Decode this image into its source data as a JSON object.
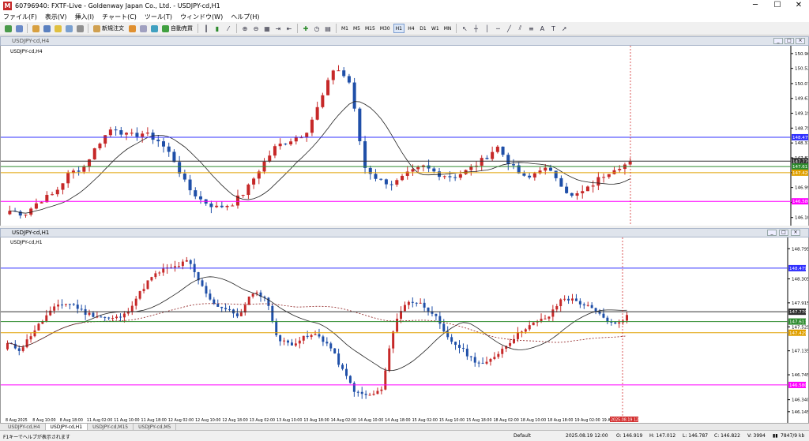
{
  "window": {
    "title": "60796940: FXTF-Live - Goldenway Japan Co., Ltd. - USDJPY-cd,H1",
    "minimize": "─",
    "maximize": "☐",
    "close": "✕"
  },
  "menu": [
    "ファイル(F)",
    "表示(V)",
    "挿入(I)",
    "チャート(C)",
    "ツール(T)",
    "ウィンドウ(W)",
    "ヘルプ(H)"
  ],
  "toolbar": {
    "new_order_label": "新規注文",
    "auto_trade_label": "自動売買",
    "timeframes": [
      "M1",
      "M5",
      "M15",
      "M30",
      "H1",
      "H4",
      "D1",
      "W1",
      "MN"
    ],
    "active_timeframe": "H1"
  },
  "top_chart": {
    "window_title": "USDJPY-cd,H4",
    "symbol_label": "USDJPY-cd,H4",
    "price_labels": [
      "150.960",
      "150.520",
      "150.070",
      "149.630",
      "149.190",
      "148.750",
      "148.310",
      "147.870",
      "147.430",
      "146.990",
      "146.550",
      "146.100"
    ],
    "hlines": [
      {
        "price": "148.479",
        "color": "#3030ff"
      },
      {
        "price": "147.770",
        "color": "#303030"
      },
      {
        "price": "147.611",
        "color": "#2e8b2e"
      },
      {
        "price": "147.429",
        "color": "#e0a000"
      },
      {
        "price": "146.580",
        "color": "#ff00ff"
      }
    ],
    "xlabels": []
  },
  "bottom_chart": {
    "window_title": "USDJPY-cd,H1",
    "symbol_label": "USDJPY-cd,H1",
    "price_labels": [
      "148.795",
      "148.305",
      "147.915",
      "147.525",
      "147.135",
      "146.745",
      "146.340",
      "146.145"
    ],
    "hlines": [
      {
        "price": "148.479",
        "color": "#3030ff"
      },
      {
        "price": "147.770",
        "color": "#303030"
      },
      {
        "price": "147.611",
        "color": "#2e8b2e"
      },
      {
        "price": "147.429",
        "color": "#e0a000"
      },
      {
        "price": "146.580",
        "color": "#ff00ff"
      }
    ],
    "xlabels": [
      "8 Aug 2025",
      "8 Aug 10:00",
      "8 Aug 18:00",
      "11 Aug 02:00",
      "11 Aug 10:00",
      "11 Aug 18:00",
      "12 Aug 02:00",
      "12 Aug 10:00",
      "12 Aug 18:00",
      "13 Aug 02:00",
      "13 Aug 10:00",
      "13 Aug 18:00",
      "14 Aug 02:00",
      "14 Aug 10:00",
      "14 Aug 18:00",
      "15 Aug 02:00",
      "15 Aug 10:00",
      "15 Aug 18:00",
      "18 Aug 02:00",
      "18 Aug 10:00",
      "18 Aug 18:00",
      "19 Aug 02:00",
      "19 Aug 10:00"
    ],
    "cursor_time": "2025.08.19 12:00"
  },
  "tabs": [
    "USDJPY-cd,H4",
    "USDJPY-cd,H1",
    "USDJPY-cd,M15",
    "USDJPY-cd,M5"
  ],
  "active_tab": "USDJPY-cd,H1",
  "status": {
    "help": "F1キーでヘルプが表示されます",
    "profile": "Default",
    "datetime": "2025.08.19 12:00",
    "open": "O: 146.919",
    "high": "H: 147.012",
    "low": "L: 146.787",
    "close": "C: 146.822",
    "volume": "V: 3994",
    "traffic": "7847/9 kb"
  }
}
